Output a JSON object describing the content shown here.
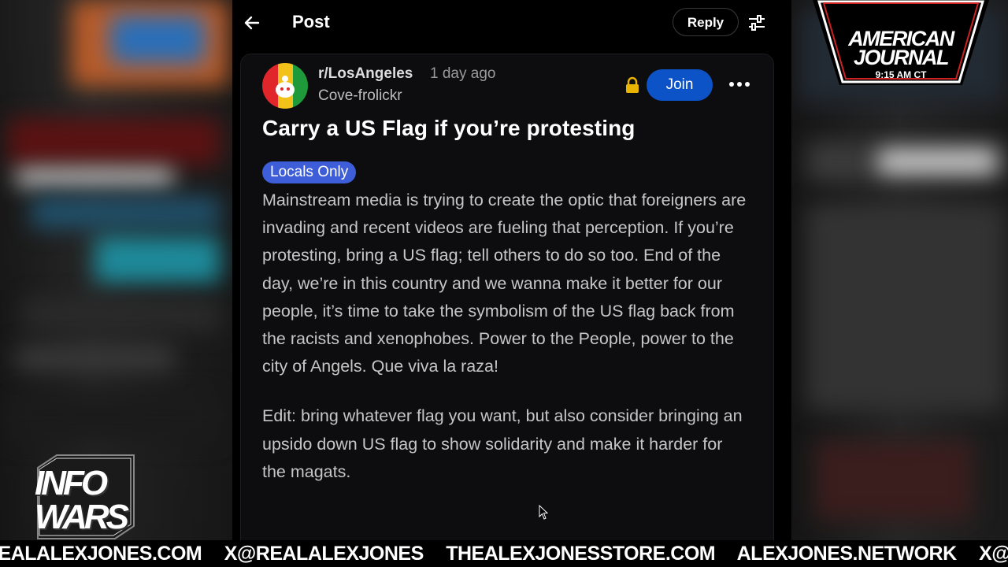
{
  "header": {
    "back_label": "←",
    "title": "Post",
    "reply_label": "Reply"
  },
  "post": {
    "subreddit": "r/LosAngeles",
    "time": "1 day ago",
    "author": "Cove-frolickr",
    "join_label": "Join",
    "title": "Carry a US Flag if you’re protesting",
    "flair": "Locals Only",
    "body": "Mainstream media is trying to create the optic that foreigners are invading and recent videos are fueling that perception. If you’re protesting, bring a US flag; tell others to do so too. End of the day, we’re in this country and we wanna make it better for our people, it’s time to take the symbolism of the US flag back from the racists and xenophobes. Power to the People, power to the city of Angels. Que viva la raza!",
    "edit": "Edit: bring whatever flag you want, but also consider bringing an upsido down US flag to show solidarity and make it harder for the magats."
  },
  "overlay": {
    "aj_line1": "AMERICAN",
    "aj_line2": "JOURNAL",
    "aj_time": "9:15 AM CT",
    "iw_line1": "INFO",
    "iw_line2": "WARS"
  },
  "ticker": {
    "items": [
      "REALALEXJONES.COM",
      "X@REALALEXJONES",
      "THEALEXJONESSTORE.COM",
      "ALEXJONES.NETWORK",
      "X@AJNLIVE"
    ]
  },
  "icons": {
    "back": "arrow-left-icon",
    "filter": "sliders-icon",
    "lock": "lock-icon",
    "more": "more-horizontal-icon"
  },
  "colors": {
    "join": "#0b53c6",
    "flair": "#3d5ed8",
    "lock": "#e8b400"
  }
}
